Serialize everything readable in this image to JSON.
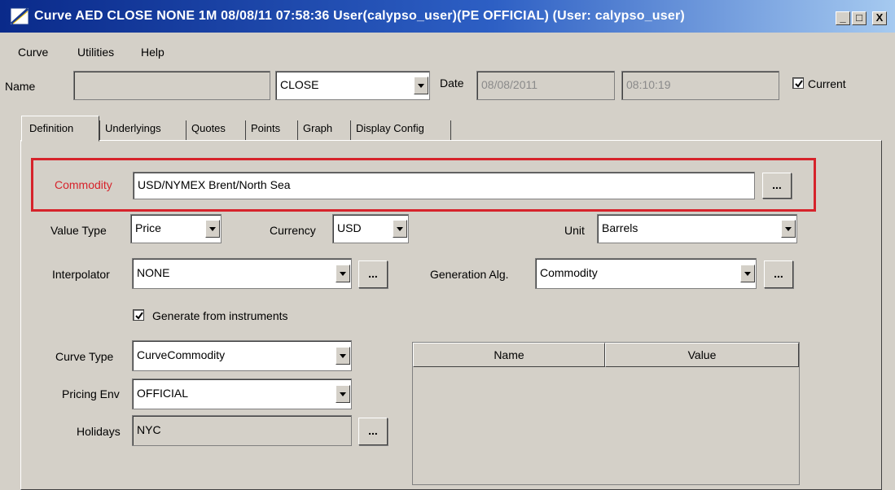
{
  "window": {
    "title": "Curve  AED CLOSE NONE 1M 08/08/11 07:58:36 User(calypso_user)(PE OFFICIAL) (User: calypso_user)",
    "minimize": "_",
    "maximize": "□",
    "close": "X"
  },
  "menu": [
    "Curve",
    "Utilities",
    "Help"
  ],
  "header": {
    "name_label": "Name",
    "name_value": "",
    "set_value": "CLOSE",
    "date_label": "Date",
    "date_value": "08/08/2011",
    "time_value": "08:10:19",
    "current_label": "Current",
    "current_checked": true
  },
  "tabs": [
    "Definition",
    "Underlyings",
    "Quotes",
    "Points",
    "Graph",
    "Display Config"
  ],
  "definition": {
    "commodity_label": "Commodity",
    "commodity_value": "USD/NYMEX Brent/North Sea",
    "value_type_label": "Value Type",
    "value_type_value": "Price",
    "currency_label": "Currency",
    "currency_value": "USD",
    "unit_label": "Unit",
    "unit_value": "Barrels",
    "interpolator_label": "Interpolator",
    "interpolator_value": "NONE",
    "generation_label": "Generation Alg.",
    "generation_value": "Commodity",
    "generate_label": "Generate from instruments",
    "generate_checked": true,
    "curve_type_label": "Curve Type",
    "curve_type_value": "CurveCommodity",
    "pricing_env_label": "Pricing Env",
    "pricing_env_value": "OFFICIAL",
    "holidays_label": "Holidays",
    "holidays_value": "NYC",
    "ellipsis": "..."
  },
  "table": {
    "columns": [
      "Name",
      "Value"
    ],
    "rows": []
  },
  "colors": {
    "highlight": "#d6232b",
    "commodity_label": "#d6232b",
    "titlebar_start": "#0a2a8a",
    "titlebar_end": "#a6caf0",
    "window_bg": "#d4d0c8"
  }
}
